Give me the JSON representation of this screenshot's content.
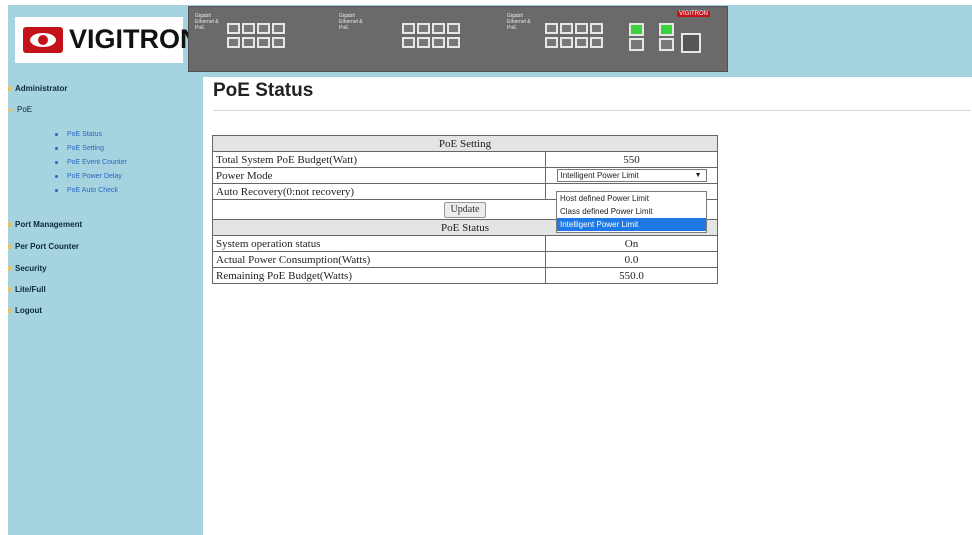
{
  "header": {
    "brand": "VIGITRON",
    "panel_brand": "VIGITRON",
    "panel_label": "Gigabit Ethernet & PoE",
    "port_numbers_top": [
      "1",
      "2",
      "3",
      "4"
    ],
    "port_numbers_bottom": [
      "5",
      "6",
      "7",
      "8"
    ]
  },
  "sidebar": {
    "items": [
      {
        "label": "Administrator"
      },
      {
        "label": "PoE"
      },
      {
        "label": "Port Management"
      },
      {
        "label": "Per Port Counter"
      },
      {
        "label": "Security"
      },
      {
        "label": "Lite/Full"
      },
      {
        "label": "Logout"
      }
    ],
    "poe_subitems": [
      {
        "label": "PoE Status"
      },
      {
        "label": "PoE Setting"
      },
      {
        "label": "PoE Event Counter"
      },
      {
        "label": "PoE Power Delay"
      },
      {
        "label": "PoE Auto Check"
      }
    ]
  },
  "main": {
    "title": "PoE Status",
    "setting_header": "PoE Setting",
    "budget_label": "Total System PoE Budget(Watt)",
    "budget_value": "550",
    "power_mode_label": "Power Mode",
    "power_mode_value": "Intelligent Power Limit",
    "power_mode_options": [
      "Host defined Power Limit",
      "Class defined Power Limit",
      "Intelligent Power Limit"
    ],
    "auto_recovery_label": "Auto Recovery(0:not recovery)",
    "update_label": "Update",
    "status_header": "PoE Status",
    "status_rows": [
      {
        "label": "System operation status",
        "value": "On"
      },
      {
        "label": "Actual Power Consumption(Watts)",
        "value": "0.0"
      },
      {
        "label": "Remaining PoE Budget(Watts)",
        "value": "550.0"
      }
    ]
  },
  "colors": {
    "sidebar_bg": "#a6d3e0",
    "link": "#2a66c0",
    "selected_option": "#1e78e6",
    "logo_red": "#c4121a"
  }
}
